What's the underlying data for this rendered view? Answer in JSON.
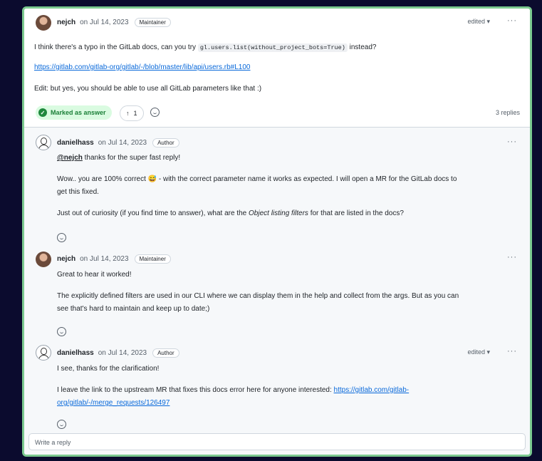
{
  "main_comment": {
    "author": "nejch",
    "date": "on Jul 14, 2023",
    "badge": "Maintainer",
    "edited": "edited ▾",
    "text_before_code": "I think there's a typo in the GitLab docs, can you try ",
    "code": "gl.users.list(without_project_bots=True)",
    "text_after_code": " instead?",
    "link": "https://gitlab.com/gitlab-org/gitlab/-/blob/master/lib/api/users.rb#L100",
    "edit_note": "Edit: but yes, you should be able to use all GitLab parameters like that :)",
    "answer_label": "Marked as answer",
    "vote_arrow": "↑",
    "vote_count": "1",
    "replies_count": "3 replies"
  },
  "replies": [
    {
      "author": "danielhass",
      "date": "on Jul 14, 2023",
      "badge": "Author",
      "mention": "@nejch",
      "line1": " thanks for the super fast reply!",
      "para2a": "Wow.. you are 100% correct 😅 - with the correct parameter name it works as expected. I will open a MR for the GitLab docs to",
      "para2b": "get this fixed.",
      "para3a": "Just out of curiosity (if you find time to answer), what are the ",
      "para3_em": "Object listing filters",
      "para3b": " for that are listed in the docs?"
    },
    {
      "author": "nejch",
      "date": "on Jul 14, 2023",
      "badge": "Maintainer",
      "line1": "Great to hear it worked!",
      "para2a": "The explicitly defined filters are used in our CLI where we can display them in the help and collect from the args. But as you can",
      "para2b": "see that's hard to maintain and keep up to date;)"
    },
    {
      "author": "danielhass",
      "date": "on Jul 14, 2023",
      "badge": "Author",
      "edited": "edited ▾",
      "line1": "I see, thanks for the clarification!",
      "para2a": "I leave the link to the upstream MR that fixes this docs error here for anyone interested: ",
      "link_a": "https://gitlab.com/gitlab-",
      "link_b": "org/gitlab/-/merge_requests/126497"
    }
  ],
  "menu_dots": "···",
  "reply_placeholder": "Write a reply"
}
